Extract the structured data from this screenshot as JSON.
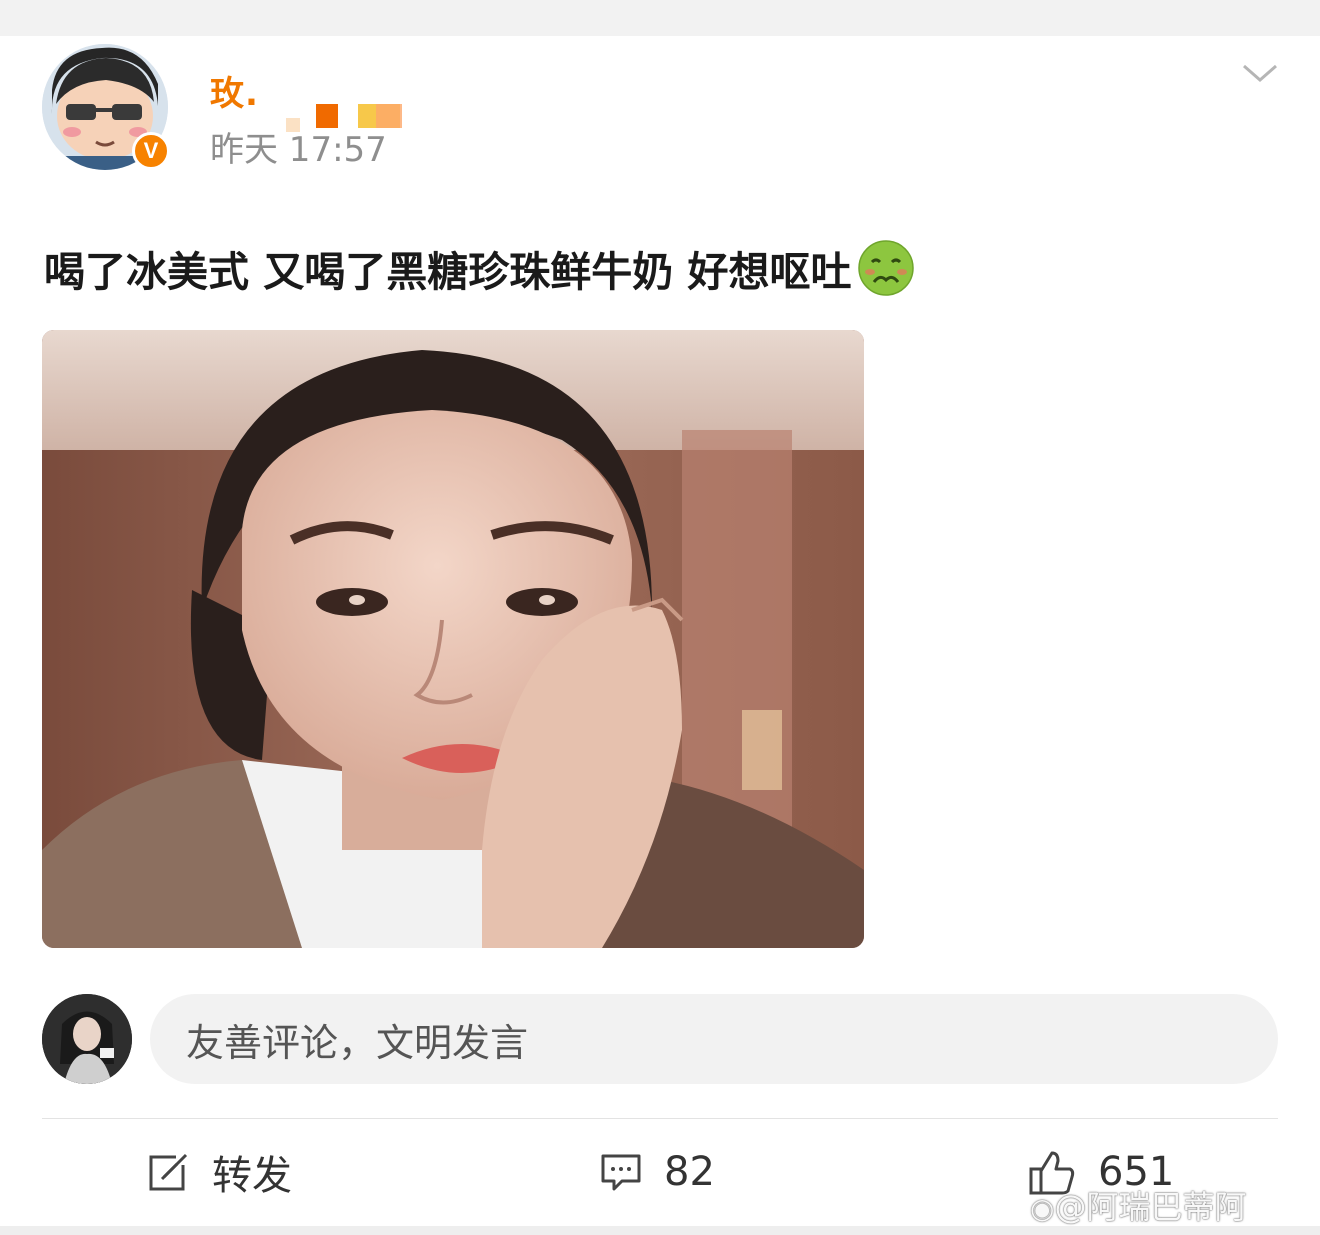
{
  "post": {
    "username": "玫.",
    "timestamp": "昨天 17:57",
    "verified_badge": "V",
    "text": "喝了冰美式 又喝了黑糖珍珠鲜牛奶 好想呕吐",
    "emoji": "nauseated-face-icon"
  },
  "comment": {
    "placeholder": "友善评论，文明发言"
  },
  "actions": {
    "repost_label": "转发",
    "comment_count": "82",
    "like_count": "651"
  },
  "watermark": "@阿瑞巴蒂阿",
  "colors": {
    "username": "#f07800",
    "badge": "#f78200",
    "timestamp": "#8e8e8e"
  }
}
